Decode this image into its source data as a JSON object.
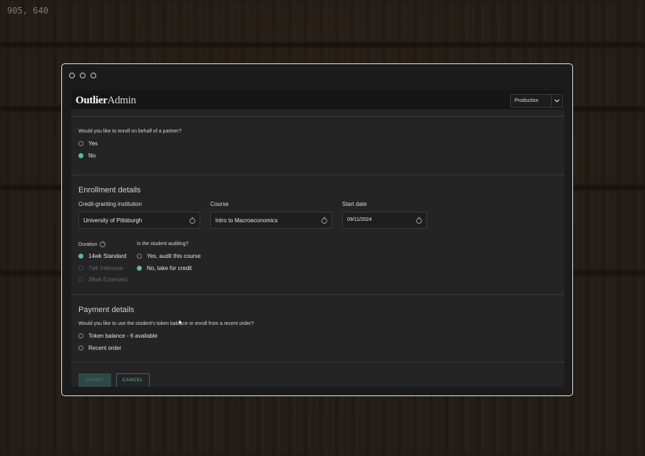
{
  "screen_dims": "905, 640",
  "window": {
    "controls": [
      "close",
      "minimize",
      "maximize"
    ]
  },
  "header": {
    "logo_bold": "Outlier",
    "logo_light": "Admin",
    "environment": "Production"
  },
  "partner": {
    "question": "Would you like to enroll on behalf of a partner?",
    "options": [
      {
        "label": "Yes",
        "selected": false
      },
      {
        "label": "No",
        "selected": true
      }
    ]
  },
  "enrollment": {
    "title": "Enrollment details",
    "institution": {
      "label": "Credit-granting institution",
      "value": "University of Pittsburgh"
    },
    "course": {
      "label": "Course",
      "value": "Intro to Macroeconomics"
    },
    "start_date": {
      "label": "Start date",
      "value": "09/11/2024"
    },
    "duration": {
      "label": "Duration",
      "options": [
        {
          "label": "14wk Standard",
          "selected": true,
          "disabled": false
        },
        {
          "label": "7wk Intensive",
          "selected": false,
          "disabled": true
        },
        {
          "label": "39wk Extended",
          "selected": false,
          "disabled": true
        }
      ]
    },
    "auditing": {
      "label": "Is the student auditing?",
      "options": [
        {
          "label": "Yes, audit this course",
          "selected": false
        },
        {
          "label": "No, take for credit",
          "selected": true
        }
      ]
    }
  },
  "payment": {
    "title": "Payment details",
    "question": "Would you like to use the student's token balance or enroll from a recent order?",
    "options": [
      {
        "label": "Token balance - 6 available",
        "selected": false
      },
      {
        "label": "Recent order",
        "selected": false
      }
    ]
  },
  "actions": {
    "submit": "SUBMIT",
    "cancel": "CANCEL"
  },
  "colors": {
    "accent": "#5fb8ad",
    "panel": "#242424",
    "topbar": "#161616"
  }
}
